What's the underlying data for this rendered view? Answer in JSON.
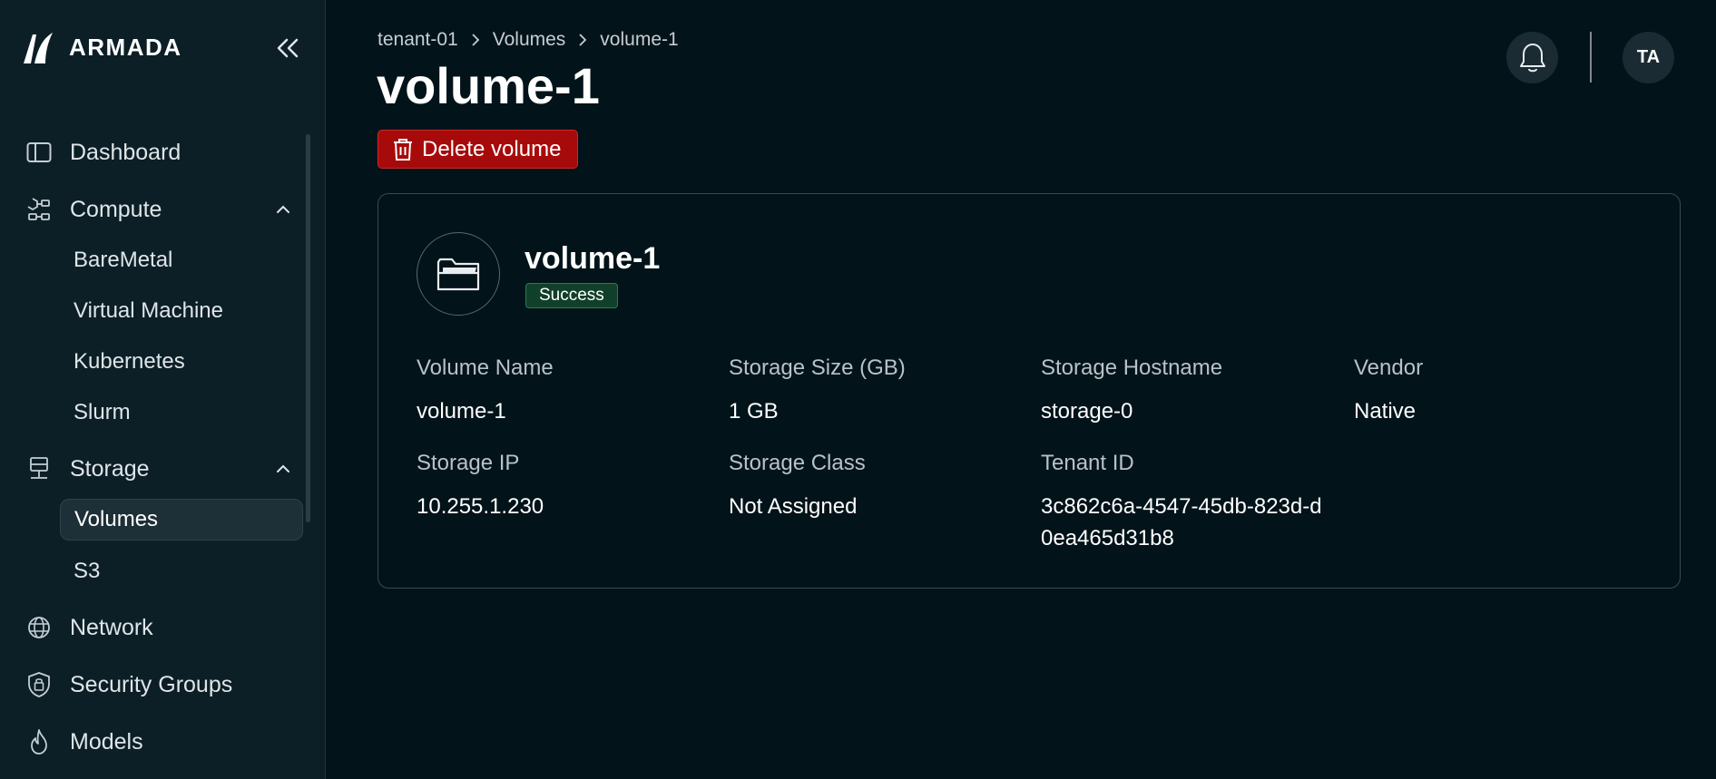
{
  "app": {
    "name": "ARMADA"
  },
  "sidebar": {
    "items": [
      {
        "label": "Dashboard"
      },
      {
        "label": "Compute",
        "children": [
          "BareMetal",
          "Virtual Machine",
          "Kubernetes",
          "Slurm"
        ]
      },
      {
        "label": "Storage",
        "children": [
          "Volumes",
          "S3"
        ],
        "active_child": "Volumes"
      },
      {
        "label": "Network"
      },
      {
        "label": "Security Groups"
      },
      {
        "label": "Models"
      }
    ]
  },
  "breadcrumb": [
    "tenant-01",
    "Volumes",
    "volume-1"
  ],
  "page": {
    "title": "volume-1",
    "delete_label": "Delete volume"
  },
  "header": {
    "avatar_initials": "TA"
  },
  "card": {
    "title": "volume-1",
    "status": "Success",
    "fields": [
      {
        "label": "Volume Name",
        "value": "volume-1"
      },
      {
        "label": "Storage Size (GB)",
        "value": "1 GB"
      },
      {
        "label": "Storage Hostname",
        "value": "storage-0"
      },
      {
        "label": "Vendor",
        "value": "Native"
      },
      {
        "label": "Storage IP",
        "value": "10.255.1.230"
      },
      {
        "label": "Storage Class",
        "value": "Not Assigned"
      },
      {
        "label": "Tenant ID",
        "value": "3c862c6a-4547-45db-823d-d0ea465d31b8"
      }
    ]
  },
  "colors": {
    "background": "#02131a",
    "sidebar": "#0c1f27",
    "danger": "#a70a0a",
    "success": "#11402a"
  }
}
